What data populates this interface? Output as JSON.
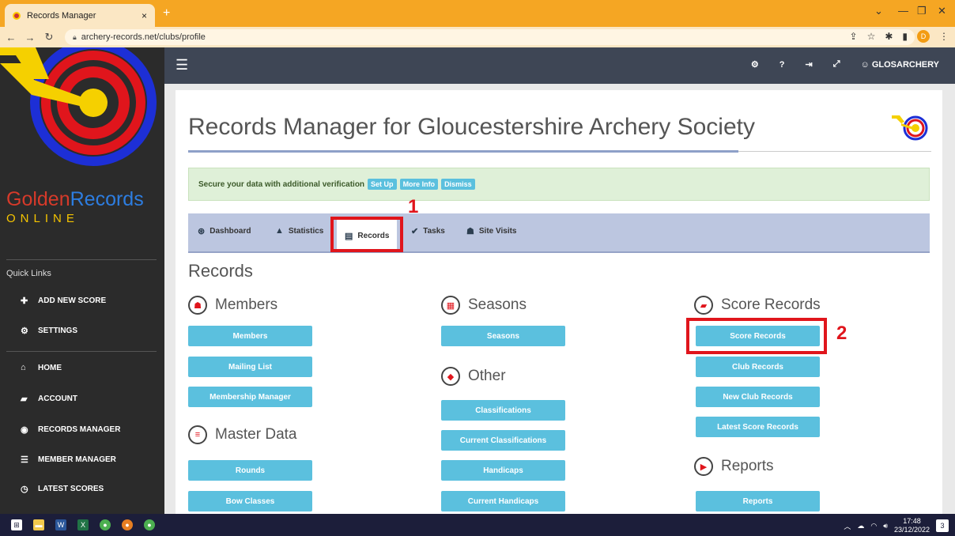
{
  "browser": {
    "tab_title": "Records Manager",
    "tab_close": "×",
    "new_tab": "+",
    "url": "archery-records.net/clubs/profile",
    "profile_initial": "D",
    "win_min": "—",
    "win_restore": "❐",
    "win_close": "✕",
    "win_dropdown": "⌄"
  },
  "sidebar": {
    "brand_golden": "Golden",
    "brand_records": "Records",
    "brand_online": "ONLINE",
    "quick_links": "Quick Links",
    "items": [
      {
        "label": "ADD NEW SCORE",
        "icon": "✚"
      },
      {
        "label": "SETTINGS",
        "icon": "⚙"
      },
      {
        "label": "HOME",
        "icon": "⌂"
      },
      {
        "label": "ACCOUNT",
        "icon": "▰"
      },
      {
        "label": "RECORDS MANAGER",
        "icon": "◉"
      },
      {
        "label": "MEMBER MANAGER",
        "icon": "☰"
      },
      {
        "label": "LATEST SCORES",
        "icon": "◷"
      }
    ]
  },
  "appnav": {
    "menu_icon": "☰",
    "user": "GLOSARCHERY",
    "help": "?"
  },
  "page": {
    "title": "Records Manager for Gloucestershire Archery Society",
    "alert_text": "Secure your data with additional verification",
    "alert_buttons": [
      "Set Up",
      "More Info",
      "Dismiss"
    ],
    "tabs": [
      {
        "label": "Dashboard",
        "icon": "⊛"
      },
      {
        "label": "Statistics",
        "icon": "▲"
      },
      {
        "label": "Records",
        "icon": "▤"
      },
      {
        "label": "Tasks",
        "icon": "✔"
      },
      {
        "label": "Site Visits",
        "icon": "☗"
      }
    ],
    "section_title": "Records",
    "annotations": [
      "1",
      "2"
    ],
    "columns": {
      "members": {
        "title": "Members",
        "buttons": [
          "Members",
          "Mailing List",
          "Membership Manager"
        ]
      },
      "master_data": {
        "title": "Master Data",
        "buttons": [
          "Rounds",
          "Bow Classes"
        ]
      },
      "seasons": {
        "title": "Seasons",
        "buttons": [
          "Seasons"
        ]
      },
      "other": {
        "title": "Other",
        "buttons": [
          "Classifications",
          "Current Classifications",
          "Handicaps",
          "Current Handicaps"
        ]
      },
      "score_records": {
        "title": "Score Records",
        "buttons": [
          "Score Records",
          "Club Records",
          "New Club Records",
          "Latest Score Records"
        ]
      },
      "reports": {
        "title": "Reports",
        "buttons": [
          "Reports"
        ]
      }
    }
  },
  "taskbar": {
    "time": "17:48",
    "date": "23/12/2022",
    "notifications": "3"
  },
  "colors": {
    "accent_button": "#5bc0de",
    "highlight_red": "#e0151c",
    "sidebar_bg": "#2b2b2b",
    "appnav_bg": "#3e4655"
  }
}
